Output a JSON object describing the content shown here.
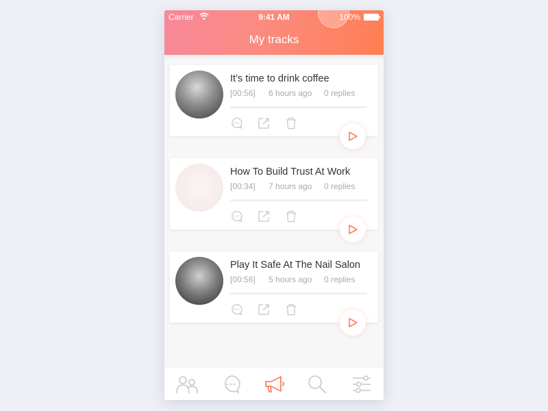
{
  "status_bar": {
    "carrier": "Carrier",
    "time": "9:41 AM",
    "battery": "100%"
  },
  "header": {
    "title": "My tracks"
  },
  "colors": {
    "accent": "#ff7f5a",
    "gradient_start": "#f7889a",
    "gradient_end": "#ff7f52"
  },
  "tracks": [
    {
      "title": "It’s time to drink coffee",
      "duration": "[00:56]",
      "time_ago": "6 hours ago",
      "replies": "0 replies",
      "progress": 0
    },
    {
      "title": "How To Build Trust At Work",
      "duration": "[00:34]",
      "time_ago": "7 hours ago",
      "replies": "0 replies",
      "progress": 0
    },
    {
      "title": "Play It Safe At The Nail Salon",
      "duration": "[00:56]",
      "time_ago": "5 hours ago",
      "replies": "0 replies",
      "progress": 0
    }
  ],
  "card_actions": [
    "comment-icon",
    "share-icon",
    "delete-icon"
  ],
  "tabbar": {
    "tabs": [
      {
        "icon": "people-icon",
        "active": false
      },
      {
        "icon": "chat-icon",
        "active": false
      },
      {
        "icon": "megaphone-icon",
        "active": true
      },
      {
        "icon": "search-icon",
        "active": false
      },
      {
        "icon": "settings-sliders-icon",
        "active": false
      }
    ]
  }
}
